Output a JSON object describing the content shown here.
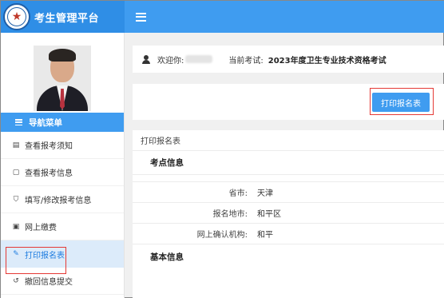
{
  "app": {
    "title": "考生管理平台"
  },
  "header": {
    "welcome_label": "欢迎你:",
    "current_exam_label": "当前考试:",
    "current_exam_name": "2023年度卫生专业技术资格考试"
  },
  "sidebar": {
    "nav_title": "导航菜单",
    "items": [
      {
        "label": "查看报考须知",
        "icon": "notice-icon",
        "active": false
      },
      {
        "label": "查看报考信息",
        "icon": "info-icon",
        "active": false
      },
      {
        "label": "填写/修改报考信息",
        "icon": "shield-check-icon",
        "active": false
      },
      {
        "label": "网上缴费",
        "icon": "payment-icon",
        "active": false
      },
      {
        "label": "打印报名表",
        "icon": "print-form-icon",
        "active": true
      },
      {
        "label": "撤回信息提交",
        "icon": "undo-icon",
        "active": false
      }
    ]
  },
  "toolbar": {
    "print_button_label": "打印报名表"
  },
  "panel": {
    "title": "打印报名表",
    "exam_site_section": "考点信息",
    "fields": [
      {
        "label": "省市:",
        "value": "天津"
      },
      {
        "label": "报名地市:",
        "value": "和平区"
      },
      {
        "label": "网上确认机构:",
        "value": "和平"
      }
    ],
    "basic_info_section": "基本信息"
  },
  "colors": {
    "brand_blue": "#2f8ee6",
    "header_blue": "#3f9cf0",
    "active_bg": "#dcebfa",
    "highlight_red": "#e53935"
  }
}
